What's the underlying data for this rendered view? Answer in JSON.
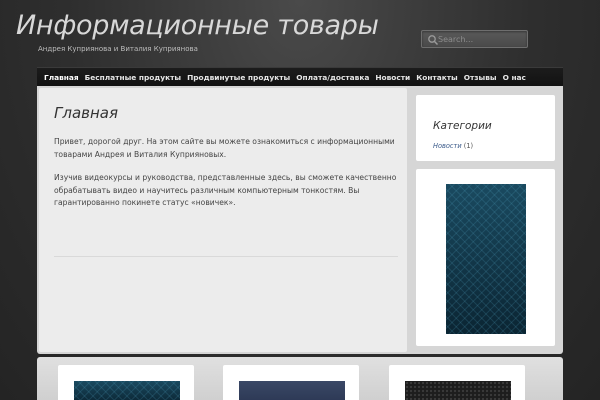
{
  "header": {
    "site_title": "Информационные товары",
    "tagline": "Андрея Куприянова и Виталия Куприянова"
  },
  "search": {
    "placeholder": "Search...",
    "value": ""
  },
  "nav": {
    "items": [
      {
        "label": "Главная",
        "active": true
      },
      {
        "label": "Бесплатные продукты"
      },
      {
        "label": "Продвинутые продукты"
      },
      {
        "label": "Оплата/доставка"
      },
      {
        "label": "Новости"
      },
      {
        "label": "Контакты"
      },
      {
        "label": "Отзывы"
      },
      {
        "label": "О нас"
      }
    ]
  },
  "main": {
    "heading": "Главная",
    "paragraph_1": "Привет, дорогой друг. На этом сайте вы можете ознакомиться с информационными товарами Андрея и Виталия Куприяновых.",
    "paragraph_2": "Изучив видеокурсы и руководства, представленные здесь, вы сможете качественно обрабатывать видео и научитесь различным компьютерным тонкостям. Вы гарантированно покинете статус «новичек»."
  },
  "sidebar": {
    "categories_title": "Категории",
    "categories": [
      {
        "name": "Новости",
        "count": "(1)"
      }
    ]
  },
  "colors": {
    "background": "#2e2e2e",
    "navbar": "#161616",
    "content_panel": "#ececec",
    "link": "#3a5a8a",
    "thumb_teal": "#0f3345"
  }
}
